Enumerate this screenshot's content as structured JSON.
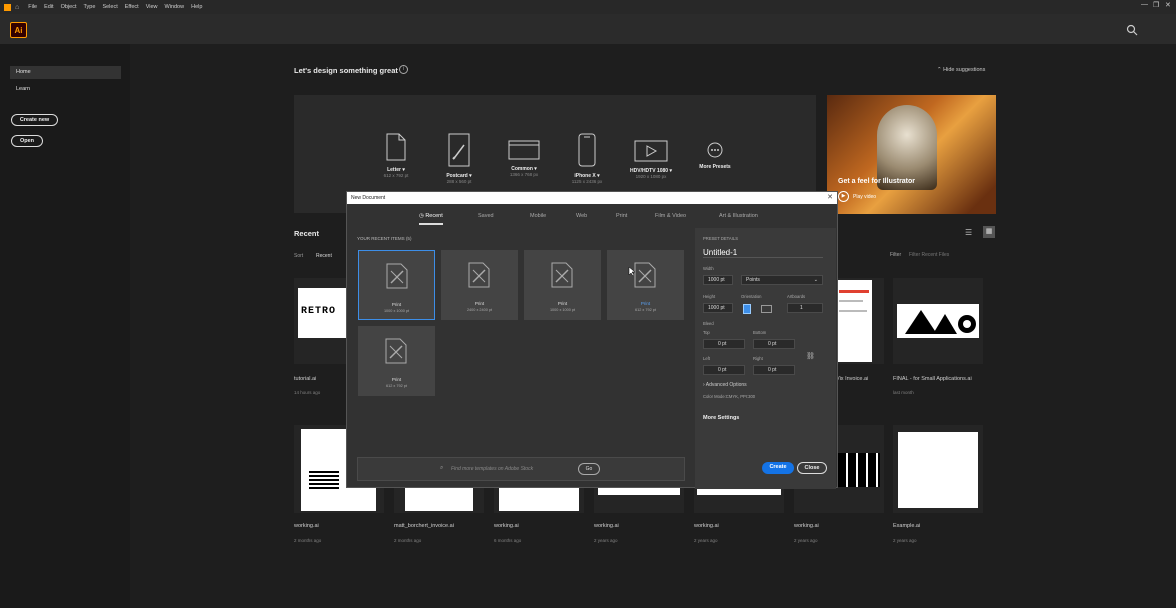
{
  "menu": [
    "File",
    "Edit",
    "Object",
    "Type",
    "Select",
    "Effect",
    "View",
    "Window",
    "Help"
  ],
  "app_logo": "Ai",
  "sidebar": {
    "items": [
      "Home",
      "Learn"
    ],
    "create_new": "Create new",
    "open": "Open"
  },
  "main": {
    "heading": "Let's design something great",
    "hide_suggestions": "Hide suggestions",
    "presets": [
      {
        "label": "Letter",
        "size": "612 x 792 pt"
      },
      {
        "label": "Postcard",
        "size": "288 x 560 pt"
      },
      {
        "label": "Common",
        "size": "1366 x 768 px"
      },
      {
        "label": "iPhone X",
        "size": "1125 x 2436 px"
      },
      {
        "label": "HDV/HDTV 1080",
        "size": "1920 x 1080 px"
      },
      {
        "label": "More Presets",
        "size": ""
      }
    ],
    "promo": {
      "title": "Get a feel for Illustrator",
      "play": "Play video"
    },
    "recent_heading": "Recent",
    "sort_label": "Sort",
    "sort_value": "Recent",
    "filter_label": "Filter",
    "filter_placeholder": "Filter Recent Files",
    "row1": [
      {
        "name": "tutorial.ai",
        "date": "14 hours ago"
      },
      {
        "name": "Vix Invoice.ai",
        "date": ""
      },
      {
        "name": "FINAL - for Small Applications.ai",
        "date": "last month"
      }
    ],
    "row2": [
      {
        "name": "working.ai",
        "date": "2 months ago"
      },
      {
        "name": "matt_borchert_invoice.ai",
        "date": "2 months ago"
      },
      {
        "name": "working.ai",
        "date": "6 months ago"
      },
      {
        "name": "working.ai",
        "date": "2 years ago"
      },
      {
        "name": "working.ai",
        "date": "2 years ago"
      },
      {
        "name": "working.ai",
        "date": "2 years ago"
      },
      {
        "name": "Example.ai",
        "date": "2 years ago"
      }
    ],
    "retro_text": "RETRO"
  },
  "dialog": {
    "title": "New Document",
    "tabs": [
      "Recent",
      "Saved",
      "Mobile",
      "Web",
      "Print",
      "Film & Video",
      "Art & Illustration"
    ],
    "recent_label": "YOUR RECENT ITEMS",
    "recent_count": "(5)",
    "items": [
      {
        "title": "Print",
        "size": "1000 x 1000 pt"
      },
      {
        "title": "Print",
        "size": "2400 x 2400 pt"
      },
      {
        "title": "Print",
        "size": "1000 x 1000 pt"
      },
      {
        "title": "Print",
        "size": "612 x 792 pt"
      },
      {
        "title": "Print",
        "size": "612 x 792 pt"
      }
    ],
    "search_placeholder": "Find more templates on Adobe Stock",
    "go": "Go",
    "details": {
      "heading": "PRESET DETAILS",
      "name": "Untitled-1",
      "width_label": "Width",
      "width": "1000 pt",
      "units": "Points",
      "height_label": "Height",
      "height": "1000 pt",
      "orientation_label": "Orientation",
      "artboards_label": "Artboards",
      "artboards": "1",
      "bleed_label": "Bleed",
      "top_label": "Top",
      "top": "0 pt",
      "bottom_label": "Bottom",
      "bottom": "0 pt",
      "left_label": "Left",
      "left": "0 pt",
      "right_label": "Right",
      "right": "0 pt",
      "advanced": "Advanced Options",
      "color_mode": "Color Mode:CMYK, PPI:300",
      "more_settings": "More Settings",
      "create": "Create",
      "close": "Close"
    }
  },
  "colors": {
    "accent": "#1473e6",
    "orange": "#ff9a00"
  }
}
